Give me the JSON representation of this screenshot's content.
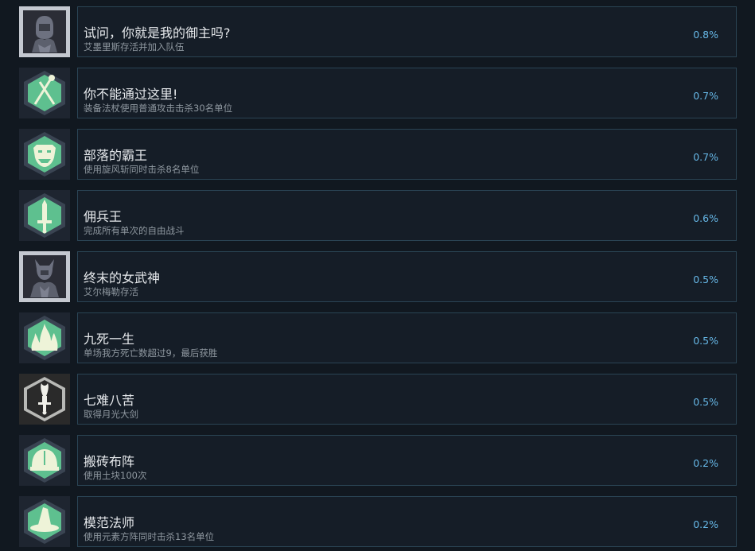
{
  "achievements": [
    {
      "title": "试问，你就是我的御主吗?",
      "desc": "艾墨里斯存活并加入队伍",
      "percent": "0.8%",
      "icon": "knight-bust-icon"
    },
    {
      "title": "你不能通过这里!",
      "desc": "装备法杖使用普通攻击击杀30名单位",
      "percent": "0.7%",
      "icon": "crossed-staffs-icon"
    },
    {
      "title": "部落的霸王",
      "desc": "使用旋风斩同时击杀8名单位",
      "percent": "0.7%",
      "icon": "orc-face-icon"
    },
    {
      "title": "佣兵王",
      "desc": "完成所有单次的自由战斗",
      "percent": "0.6%",
      "icon": "sword-icon"
    },
    {
      "title": "终末的女武神",
      "desc": "艾尔梅勒存活",
      "percent": "0.5%",
      "icon": "valkyrie-bust-icon"
    },
    {
      "title": "九死一生",
      "desc": "单场我方死亡数超过9，最后获胜",
      "percent": "0.5%",
      "icon": "flames-icon"
    },
    {
      "title": "七难八苦",
      "desc": "取得月光大剑",
      "percent": "0.5%",
      "icon": "moonlight-sword-icon"
    },
    {
      "title": "搬砖布阵",
      "desc": "使用土块100次",
      "percent": "0.2%",
      "icon": "helmet-icon"
    },
    {
      "title": "模范法师",
      "desc": "使用元素方阵同时击杀13名单位",
      "percent": "0.2%",
      "icon": "wizard-hat-icon"
    }
  ],
  "colors": {
    "background": "#111820",
    "card_border": "#2a4454",
    "percent_text": "#66b7e6",
    "badge_green": "#5ec08f",
    "badge_frame": "#3a4452"
  }
}
